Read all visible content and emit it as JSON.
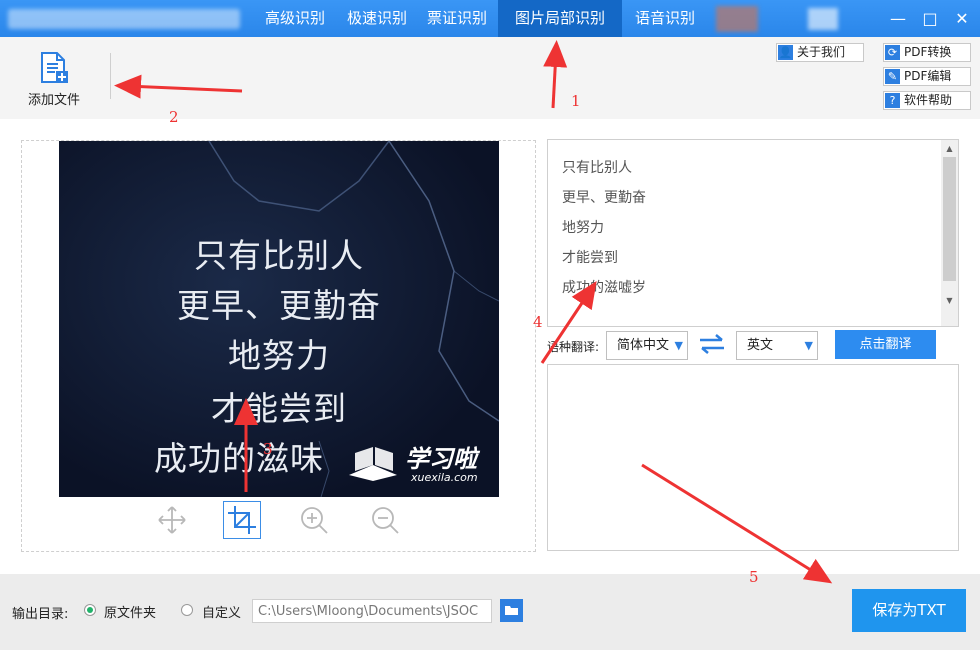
{
  "nav": {
    "tabs": [
      {
        "label": "高级识别"
      },
      {
        "label": "极速识别"
      },
      {
        "label": "票证识别"
      },
      {
        "label": "图片局部识别"
      },
      {
        "label": "语音识别"
      }
    ],
    "active_index": 3
  },
  "window_controls": {
    "minimize": "—",
    "maximize": "□",
    "close": "✕"
  },
  "toolbar": {
    "add_file_label": "添加文件",
    "about_label": "关于我们",
    "pdf_convert_label": "PDF转换",
    "pdf_edit_label": "PDF编辑",
    "help_label": "软件帮助"
  },
  "image_text": {
    "lines": [
      "只有比别人",
      "更早、更勤奋",
      "地努力",
      "才能尝到",
      "成功的滋味"
    ],
    "watermark_sub": "xuexila.com"
  },
  "ocr_result": {
    "lines": [
      "只有比别人",
      "更早、更勤奋",
      "地努力",
      "才能尝到",
      "成功的滋嘘岁"
    ]
  },
  "translate": {
    "label": "语种翻译:",
    "source_lang": "简体中文",
    "target_lang": "英文",
    "button_label": "点击翻译"
  },
  "footer": {
    "output_label": "输出目录:",
    "option_original": "原文件夹",
    "option_custom": "自定义",
    "path_value": "C:\\Users\\Mloong\\Documents\\JSOC",
    "save_label": "保存为TXT"
  },
  "annotations": [
    "1",
    "2",
    "3",
    "4",
    "5"
  ],
  "colors": {
    "accent": "#2d8cf0",
    "annotation": "#e33"
  }
}
